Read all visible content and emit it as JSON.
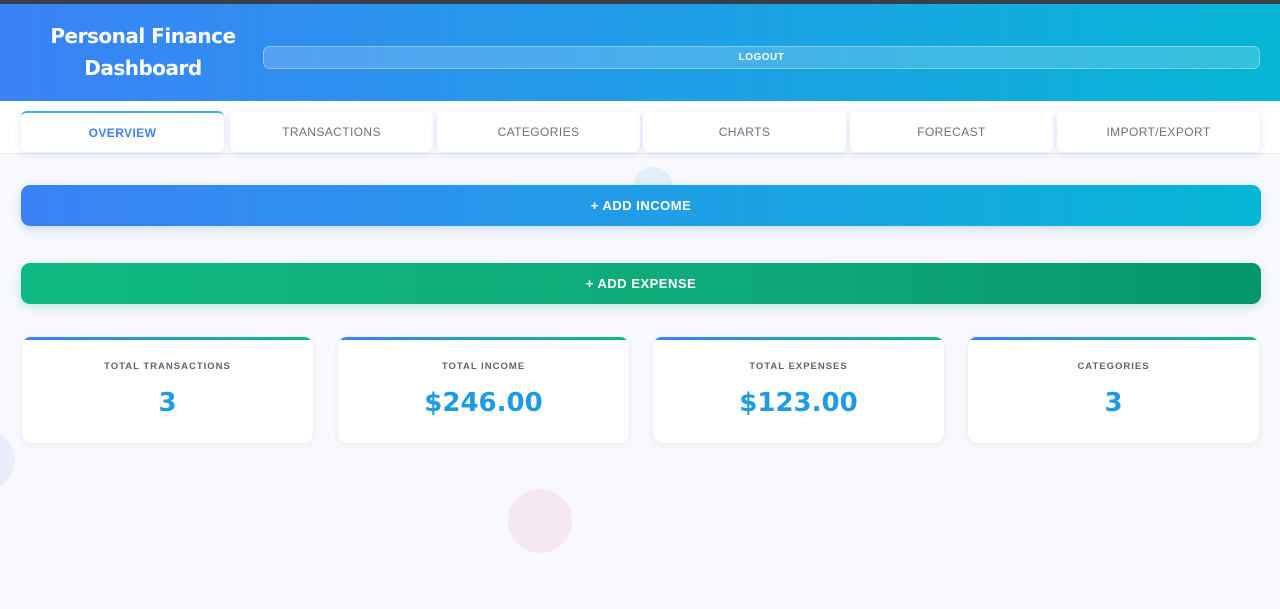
{
  "app": {
    "title_line1": "Personal Finance",
    "title_line2": "Dashboard"
  },
  "header": {
    "logout_label": "LOGOUT"
  },
  "tabs": [
    {
      "label": "OVERVIEW",
      "active": true
    },
    {
      "label": "TRANSACTIONS",
      "active": false
    },
    {
      "label": "CATEGORIES",
      "active": false
    },
    {
      "label": "CHARTS",
      "active": false
    },
    {
      "label": "FORECAST",
      "active": false
    },
    {
      "label": "IMPORT/EXPORT",
      "active": false
    }
  ],
  "actions": {
    "add_income_label": "+ ADD INCOME",
    "add_expense_label": "+ ADD EXPENSE"
  },
  "stats": [
    {
      "label": "TOTAL TRANSACTIONS",
      "value": "3"
    },
    {
      "label": "TOTAL INCOME",
      "value": "$246.00"
    },
    {
      "label": "TOTAL EXPENSES",
      "value": "$123.00"
    },
    {
      "label": "CATEGORIES",
      "value": "3"
    }
  ],
  "colors": {
    "primary_gradient_start": "#3b82f6",
    "primary_gradient_end": "#06b6d4",
    "expense_gradient_start": "#10b981",
    "expense_gradient_end": "#059669",
    "stat_value": "#1e9be2",
    "active_tab": "#3b82f6"
  }
}
